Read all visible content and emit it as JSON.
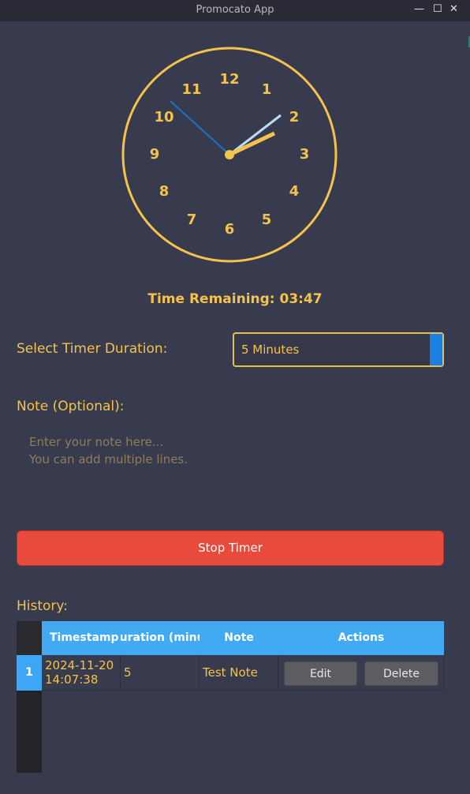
{
  "window": {
    "title": "Promocato App",
    "controls": {
      "minimize": "—",
      "maximize": "☐",
      "close": "✕"
    }
  },
  "clock": {
    "numbers": [
      "12",
      "1",
      "2",
      "3",
      "4",
      "5",
      "6",
      "7",
      "8",
      "9",
      "10",
      "11"
    ],
    "time_shown": "2:10",
    "colors": {
      "face": "#f5c34b",
      "hour_hand": "#f5c34b",
      "minute_hand": "#1a73c7",
      "second_hand": "#b8dcf7"
    }
  },
  "timer": {
    "remaining_text": "Time Remaining: 03:47"
  },
  "duration": {
    "label": "Select Timer Duration:",
    "selected": "5 Minutes"
  },
  "note": {
    "label": "Note (Optional):",
    "placeholder_lines": [
      "Enter your note here...",
      "You can add multiple lines."
    ]
  },
  "actions": {
    "stop_label": "Stop Timer"
  },
  "history": {
    "label": "History:",
    "columns": [
      "Timestamp",
      "Duration (minutes)",
      "Note",
      "Actions"
    ],
    "rows": [
      {
        "row_number": "1",
        "timestamp_date": "2024-11-20",
        "timestamp_time": "14:07:38",
        "duration": "5",
        "note": "Test Note",
        "edit_label": "Edit",
        "delete_label": "Delete"
      }
    ]
  },
  "colors": {
    "background": "#383a4d",
    "accent_yellow": "#f5c34b",
    "danger": "#e84a3c",
    "table_header": "#42aaf2",
    "select_arrow": "#1a7fe0"
  }
}
